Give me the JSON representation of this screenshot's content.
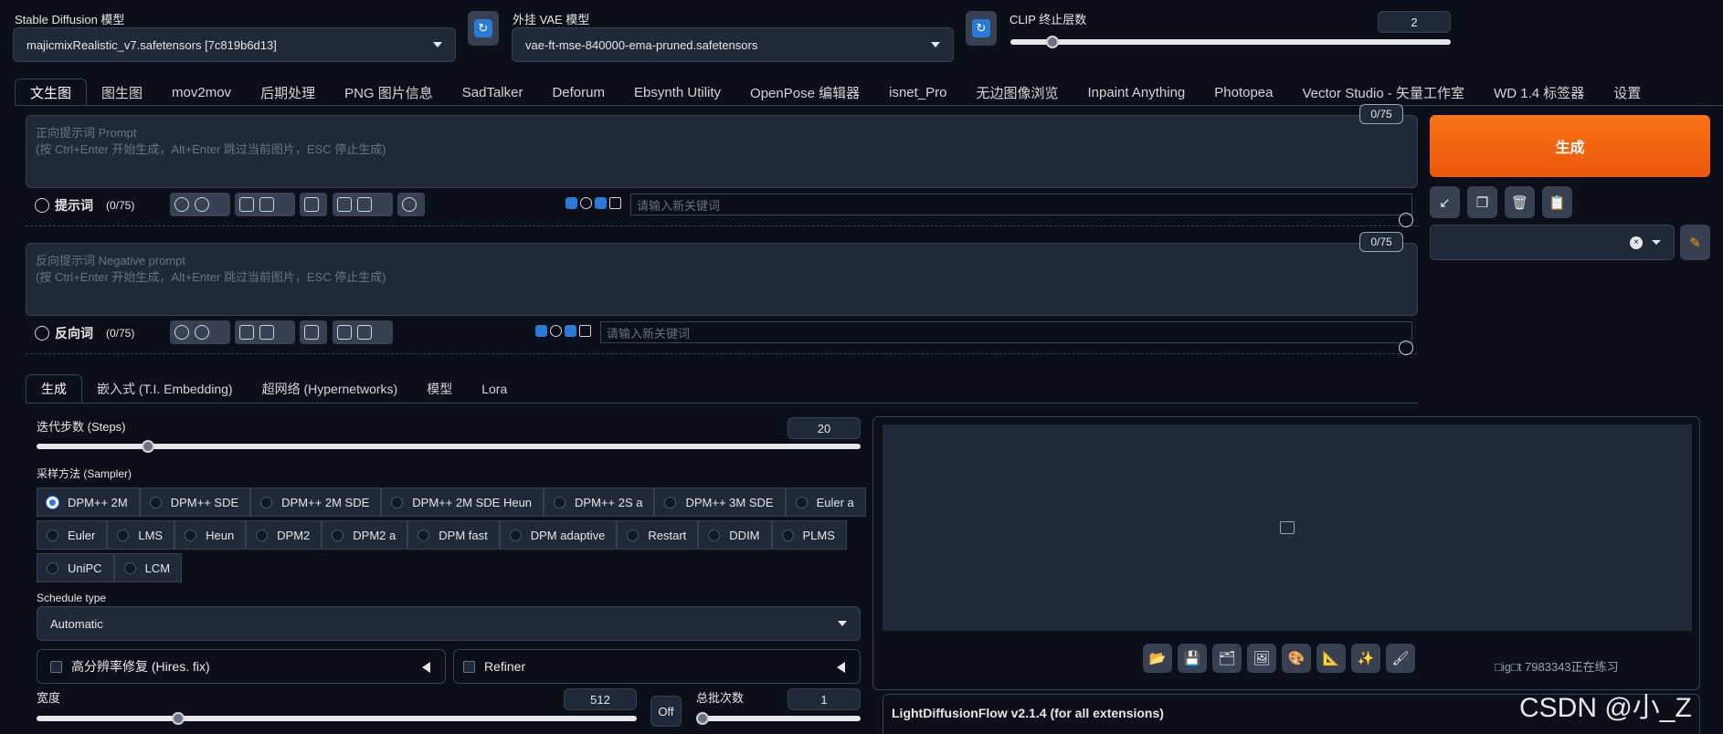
{
  "header": {
    "sd_model_label": "Stable Diffusion 模型",
    "sd_model_value": "majicmixRealistic_v7.safetensors [7c819b6d13]",
    "vae_label": "外挂 VAE 模型",
    "vae_value": "vae-ft-mse-840000-ema-pruned.safetensors",
    "clip_label": "CLIP 终止层数",
    "clip_value": "2",
    "clip_fraction": 0.083
  },
  "main_tabs": [
    "文生图",
    "图生图",
    "mov2mov",
    "后期处理",
    "PNG 图片信息",
    "SadTalker",
    "Deforum",
    "Ebsynth Utility",
    "OpenPose 编辑器",
    "isnet_Pro",
    "无边图像浏览",
    "Inpaint Anything",
    "Photopea",
    "Vector Studio - 矢量工作室",
    "WD 1.4 标签器",
    "设置"
  ],
  "prompt": {
    "placeholder_line1": "正向提示词 Prompt",
    "placeholder_line2": "(按 Ctrl+Enter 开始生成，Alt+Enter 跳过当前图片，ESC 停止生成)",
    "counter": "0/75",
    "toolbar_label": "提示词",
    "toolbar_count": "(0/75)",
    "keyword_placeholder": "请输入新关键词"
  },
  "negative": {
    "placeholder_line1": "反向提示词 Negative prompt",
    "placeholder_line2": "(按 Ctrl+Enter 开始生成，Alt+Enter 跳过当前图片，ESC 停止生成)",
    "counter": "0/75",
    "toolbar_label": "反向词",
    "toolbar_count": "(0/75)",
    "keyword_placeholder": "请输入新关键词"
  },
  "generate_label": "生成",
  "sub_tabs": [
    "生成",
    "嵌入式 (T.I. Embedding)",
    "超网络 (Hypernetworks)",
    "模型",
    "Lora"
  ],
  "steps": {
    "label": "迭代步数 (Steps)",
    "value": "20",
    "fraction": 0.13
  },
  "sampler": {
    "label": "采样方法 (Sampler)",
    "selected": "DPM++ 2M",
    "rows": [
      [
        "DPM++ 2M",
        "DPM++ SDE",
        "DPM++ 2M SDE",
        "DPM++ 2M SDE Heun",
        "DPM++ 2S a",
        "DPM++ 3M SDE",
        "Euler a"
      ],
      [
        "Euler",
        "LMS",
        "Heun",
        "DPM2",
        "DPM2 a",
        "DPM fast",
        "DPM adaptive",
        "Restart",
        "DDIM",
        "PLMS"
      ],
      [
        "UniPC",
        "LCM"
      ]
    ]
  },
  "schedule": {
    "label": "Schedule type",
    "value": "Automatic"
  },
  "hires_label": "高分辨率修复 (Hires. fix)",
  "refiner_label": "Refiner",
  "width": {
    "label": "宽度",
    "value": "512",
    "fraction": 0.23
  },
  "off_label": "Off",
  "batch": {
    "label": "总批次数",
    "value": "1",
    "fraction": 0.0
  },
  "lightflow_label": "LightDiffusionFlow v2.1.4 (for all extensions)",
  "watermark_small": "□ig□t 7983343正在练习",
  "watermark_csdn": "CSDN @小_Z"
}
